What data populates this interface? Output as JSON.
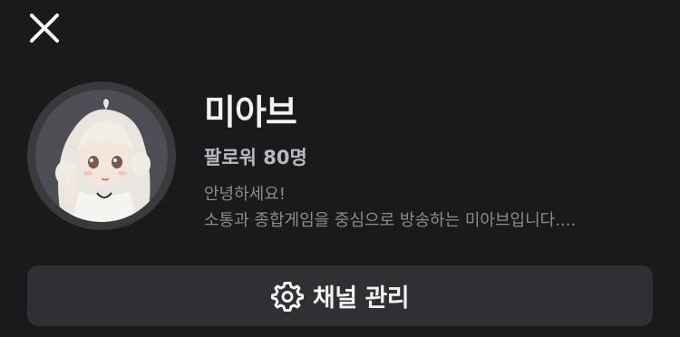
{
  "header": {
    "close_icon": "close-icon"
  },
  "profile": {
    "name": "미아브",
    "followers": "팔로워 80명",
    "bio_line1": "안녕하세요!",
    "bio_line2": "소통과 종합게임을 중심으로 방송하는 미아브입니다...."
  },
  "actions": {
    "manage_label": "채널 관리",
    "manage_icon": "gear-icon"
  },
  "colors": {
    "background": "#1a1a1c",
    "button": "#303034",
    "avatar_ring": "#3a3a3c"
  }
}
